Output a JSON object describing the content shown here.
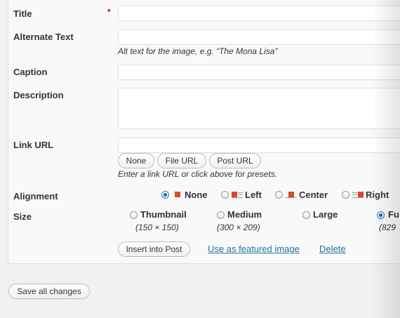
{
  "fields": {
    "title": {
      "label": "Title",
      "required_mark": "*",
      "value": ""
    },
    "alt_text": {
      "label": "Alternate Text",
      "value": "",
      "help": "Alt text for the image, e.g. “The Mona Lisa”"
    },
    "caption": {
      "label": "Caption",
      "value": ""
    },
    "description": {
      "label": "Description",
      "value": ""
    },
    "link_url": {
      "label": "Link URL",
      "value": "",
      "help": "Enter a link URL or click above for presets."
    }
  },
  "link_buttons": [
    "None",
    "File URL",
    "Post URL"
  ],
  "alignment": {
    "label": "Alignment",
    "options": [
      {
        "label": "None",
        "selected": true,
        "icon": "align-none-icon"
      },
      {
        "label": "Left",
        "selected": false,
        "icon": "align-left-icon"
      },
      {
        "label": "Center",
        "selected": false,
        "icon": "align-center-icon"
      },
      {
        "label": "Right",
        "selected": false,
        "icon": "align-right-icon"
      }
    ]
  },
  "size": {
    "label": "Size",
    "options": [
      {
        "label": "Thumbnail",
        "dims": "(150 × 150)",
        "selected": false
      },
      {
        "label": "Medium",
        "dims": "(300 × 209)",
        "selected": false
      },
      {
        "label": "Large",
        "dims": "",
        "selected": false
      },
      {
        "label": "Fu",
        "dims": "(829",
        "selected": true
      }
    ]
  },
  "actions": {
    "insert": "Insert into Post",
    "featured": "Use as featured image",
    "delete": "Delete"
  },
  "footer": {
    "save_all": "Save all changes"
  },
  "colors": {
    "link": "#21759b",
    "required": "#dd0000",
    "align_icon": "#d9472b"
  }
}
